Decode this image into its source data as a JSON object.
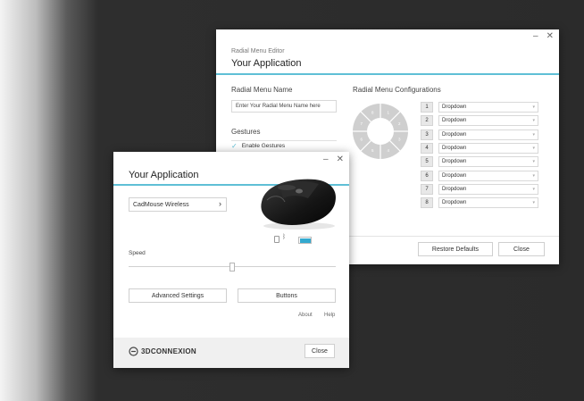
{
  "editor": {
    "subtitle": "Radial Menu Editor",
    "title": "Your Application",
    "name_label": "Radial Menu Name",
    "name_input_value": "Enter Your Radial Menu Name here",
    "gestures_label": "Gestures",
    "enable_gestures_label": "Enable Gestures",
    "configs_label": "Radial Menu Configurations",
    "rows": [
      {
        "num": "1",
        "value": "Dropdown"
      },
      {
        "num": "2",
        "value": "Dropdown"
      },
      {
        "num": "3",
        "value": "Dropdown"
      },
      {
        "num": "4",
        "value": "Dropdown"
      },
      {
        "num": "5",
        "value": "Dropdown"
      },
      {
        "num": "6",
        "value": "Dropdown"
      },
      {
        "num": "7",
        "value": "Dropdown"
      },
      {
        "num": "8",
        "value": "Dropdown"
      }
    ],
    "wheel_numbers": [
      "1",
      "2",
      "3",
      "4",
      "5",
      "6",
      "7",
      "8"
    ],
    "restore_label": "Restore Defaults",
    "close_label": "Close",
    "minimize_glyph": "–",
    "close_glyph": "✕"
  },
  "app": {
    "title": "Your Application",
    "device_select": "CadMouse Wireless",
    "speed_label": "Speed",
    "speed_level": 0.5,
    "advanced_label": "Advanced Settings",
    "buttons_label": "Buttons",
    "about_label": "About",
    "help_label": "Help",
    "brand": "3DCONNEXION",
    "close_label": "Close",
    "minimize_glyph": "–",
    "close_glyph": "✕",
    "chevron": "›"
  },
  "colors": {
    "accent": "#5fbfd6",
    "battery": "#33a9cf"
  }
}
